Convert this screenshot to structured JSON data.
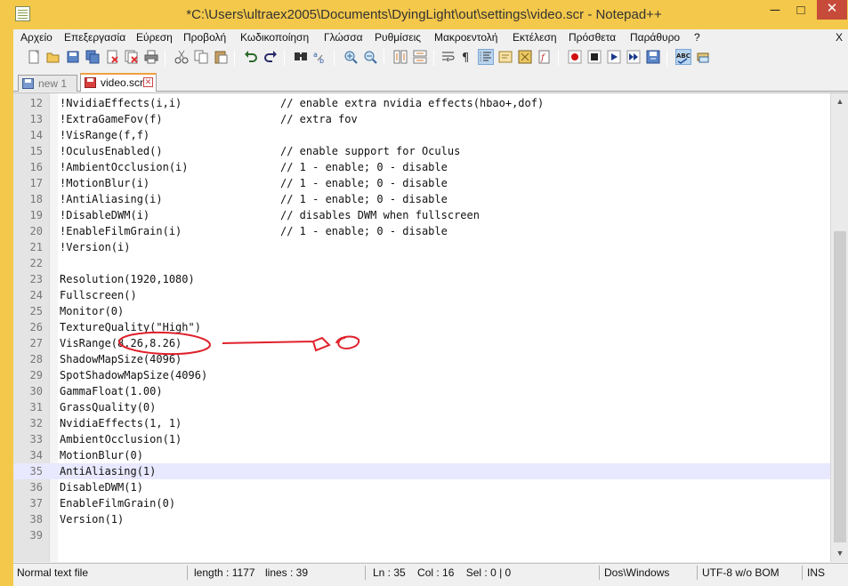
{
  "window": {
    "title": "*C:\\Users\\ultraex2005\\Documents\\DyingLight\\out\\settings\\video.scr - Notepad++",
    "minimize": "─",
    "maximize": "□",
    "close": "✕"
  },
  "menu": {
    "items": [
      "Αρχείο",
      "Επεξεργασία",
      "Εύρεση",
      "Προβολή",
      "Κωδικοποίηση",
      "Γλώσσα",
      "Ρυθμίσεις",
      "Μακροεντολή",
      "Εκτέλεση",
      "Πρόσθετα",
      "Παράθυρο",
      "?"
    ],
    "close": "X"
  },
  "toolbar": {
    "icons": [
      "new-file-icon",
      "open-file-icon",
      "save-icon",
      "save-all-icon",
      "close-icon",
      "close-all-icon",
      "print-icon",
      "cut-icon",
      "copy-icon",
      "paste-icon",
      "undo-icon",
      "redo-icon",
      "find-icon",
      "replace-icon",
      "zoom-in-icon",
      "zoom-out-icon",
      "sync-vertical-icon",
      "sync-horizontal-icon",
      "word-wrap-icon",
      "show-all-chars-icon",
      "indent-guide-icon",
      "user-defined-lang-icon",
      "doc-map-icon",
      "function-list-icon",
      "record-macro-icon",
      "stop-macro-icon",
      "play-macro-icon",
      "run-macro-multiple-icon",
      "save-macro-icon",
      "spell-check-icon",
      "spell-check-auto-icon"
    ]
  },
  "tabs": [
    {
      "label": "new  1",
      "active": false
    },
    {
      "label": "video.scr",
      "active": true
    }
  ],
  "editor": {
    "current_line": 35,
    "lines": [
      {
        "num": "12",
        "code": "!NvidiaEffects(i,i)",
        "comment": "// enable extra nvidia effects(hbao+,dof)"
      },
      {
        "num": "13",
        "code": "!ExtraGameFov(f)",
        "comment": "// extra fov"
      },
      {
        "num": "14",
        "code": "!VisRange(f,f)",
        "comment": ""
      },
      {
        "num": "15",
        "code": "!OculusEnabled()",
        "comment": "// enable support for Oculus"
      },
      {
        "num": "16",
        "code": "!AmbientOcclusion(i)",
        "comment": "// 1 - enable; 0 - disable"
      },
      {
        "num": "17",
        "code": "!MotionBlur(i)",
        "comment": "// 1 - enable; 0 - disable"
      },
      {
        "num": "18",
        "code": "!AntiAliasing(i)",
        "comment": "// 1 - enable; 0 - disable"
      },
      {
        "num": "19",
        "code": "!DisableDWM(i)",
        "comment": "// disables DWM when fullscreen"
      },
      {
        "num": "20",
        "code": "!EnableFilmGrain(i)",
        "comment": "// 1 - enable; 0 - disable"
      },
      {
        "num": "21",
        "code": "!Version(i)",
        "comment": ""
      },
      {
        "num": "22",
        "code": "",
        "comment": ""
      },
      {
        "num": "23",
        "code": "Resolution(1920,1080)",
        "comment": ""
      },
      {
        "num": "24",
        "code": "Fullscreen()",
        "comment": ""
      },
      {
        "num": "25",
        "code": "Monitor(0)",
        "comment": ""
      },
      {
        "num": "26",
        "code": "TextureQuality(\"High\")",
        "comment": ""
      },
      {
        "num": "27",
        "code": "VisRange(8.26,8.26)",
        "comment": ""
      },
      {
        "num": "28",
        "code": "ShadowMapSize(4096)",
        "comment": ""
      },
      {
        "num": "29",
        "code": "SpotShadowMapSize(4096)",
        "comment": ""
      },
      {
        "num": "30",
        "code": "GammaFloat(1.00)",
        "comment": ""
      },
      {
        "num": "31",
        "code": "GrassQuality(0)",
        "comment": ""
      },
      {
        "num": "32",
        "code": "NvidiaEffects(1, 1)",
        "comment": ""
      },
      {
        "num": "33",
        "code": "AmbientOcclusion(1)",
        "comment": ""
      },
      {
        "num": "34",
        "code": "MotionBlur(0)",
        "comment": ""
      },
      {
        "num": "35",
        "code": "AntiAliasing(1)",
        "comment": ""
      },
      {
        "num": "36",
        "code": "DisableDWM(1)",
        "comment": ""
      },
      {
        "num": "37",
        "code": "EnableFilmGrain(0)",
        "comment": ""
      },
      {
        "num": "38",
        "code": "Version(1)",
        "comment": ""
      },
      {
        "num": "39",
        "code": "",
        "comment": ""
      }
    ]
  },
  "statusbar": {
    "file_type": "Normal text file",
    "length": "length : 1177",
    "lines": "lines : 39",
    "position": "Ln : 35    Col : 16    Sel : 0 | 0",
    "eol": "Dos\\Windows",
    "encoding": "UTF-8 w/o BOM",
    "mode": "INS"
  },
  "colors": {
    "title_bar": "#f4c84a",
    "annotation": "#e0202a",
    "current_line": "#e8e8ff"
  }
}
